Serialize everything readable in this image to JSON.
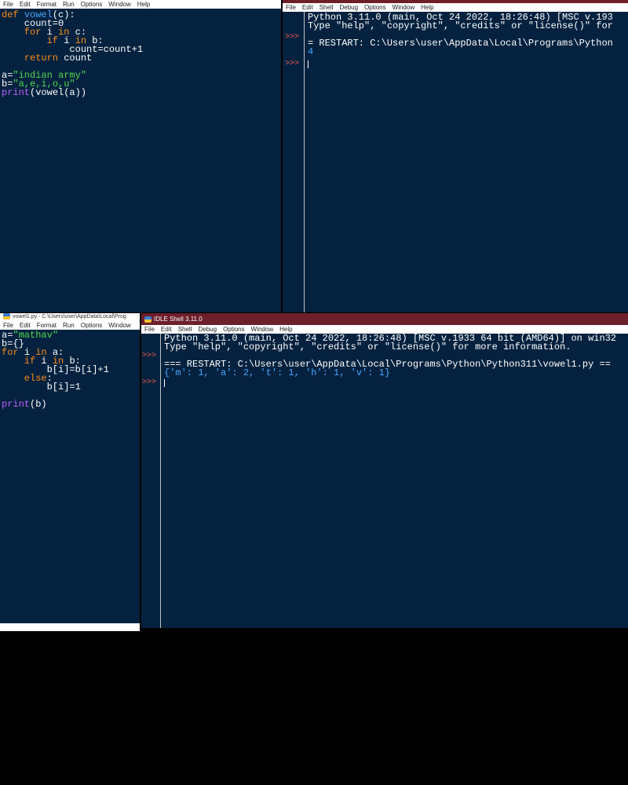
{
  "editor1": {
    "menu": [
      "File",
      "Edit",
      "Format",
      "Run",
      "Options",
      "Window",
      "Help"
    ],
    "code": [
      [
        "kw:def ",
        "fn:vowel",
        "t:(c):"
      ],
      [
        "t:    count=0"
      ],
      [
        "kw:    for ",
        "t:i ",
        "kw:in ",
        "t:c:"
      ],
      [
        "kw:        if ",
        "t:i ",
        "kw:in ",
        "t:b:"
      ],
      [
        "t:            count=count+1"
      ],
      [
        "kw:    return ",
        "t:count"
      ],
      [
        "t:"
      ],
      [
        "t:a=",
        "str:\"indian army\""
      ],
      [
        "t:b=",
        "str:\"a,e,i,o,u\""
      ],
      [
        "bi:print",
        "t:(vowel(a))"
      ]
    ]
  },
  "shell1": {
    "menu": [
      "File",
      "Edit",
      "Shell",
      "Debug",
      "Options",
      "Window",
      "Help"
    ],
    "lines": [
      "Python 3.11.0 (main, Oct 24 2022, 18:26:48) [MSC v.193",
      "Type \"help\", \"copyright\", \"credits\" or \"license()\" for",
      "",
      "= RESTART: C:\\Users\\user\\AppData\\Local\\Programs\\Python",
      "4"
    ],
    "prompt": ">>>"
  },
  "editor2": {
    "title": "vowel1.py - C:\\Users\\user\\AppData\\Local\\Prog",
    "menu": [
      "File",
      "Edit",
      "Format",
      "Run",
      "Options",
      "Window"
    ],
    "code": [
      [
        "t:a=",
        "str:\"mathav\""
      ],
      [
        "t:b={}"
      ],
      [
        "kw:for ",
        "t:i ",
        "kw:in ",
        "t:a:"
      ],
      [
        "kw:    if ",
        "t:i ",
        "kw:in ",
        "t:b:"
      ],
      [
        "t:        b[i]=b[i]+1"
      ],
      [
        "kw:    else",
        "t::"
      ],
      [
        "t:        b[i]=1"
      ],
      [
        "t:"
      ],
      [
        "bi:print",
        "t:(b)"
      ]
    ]
  },
  "shell2": {
    "title": "IDLE Shell 3.11.0",
    "menu": [
      "File",
      "Edit",
      "Shell",
      "Debug",
      "Options",
      "Window",
      "Help"
    ],
    "lines": [
      "Python 3.11.0 (main, Oct 24 2022, 18:26:48) [MSC v.1933 64 bit (AMD64)] on win32",
      "Type \"help\", \"copyright\", \"credits\" or \"license()\" for more information.",
      "",
      "=== RESTART: C:\\Users\\user\\AppData\\Local\\Programs\\Python\\Python311\\vowel1.py ==",
      "{'m': 1, 'a': 2, 't': 1, 'h': 1, 'v': 1}"
    ],
    "prompt": ">>>"
  },
  "colors": {
    "background": "#04223f",
    "keyword": "#ff8c1a",
    "string": "#4fd84f",
    "function": "#4aa3ff",
    "builtin": "#c060ff",
    "prompt": "#ff5a4a",
    "shell_title": "#6d1f2a"
  }
}
